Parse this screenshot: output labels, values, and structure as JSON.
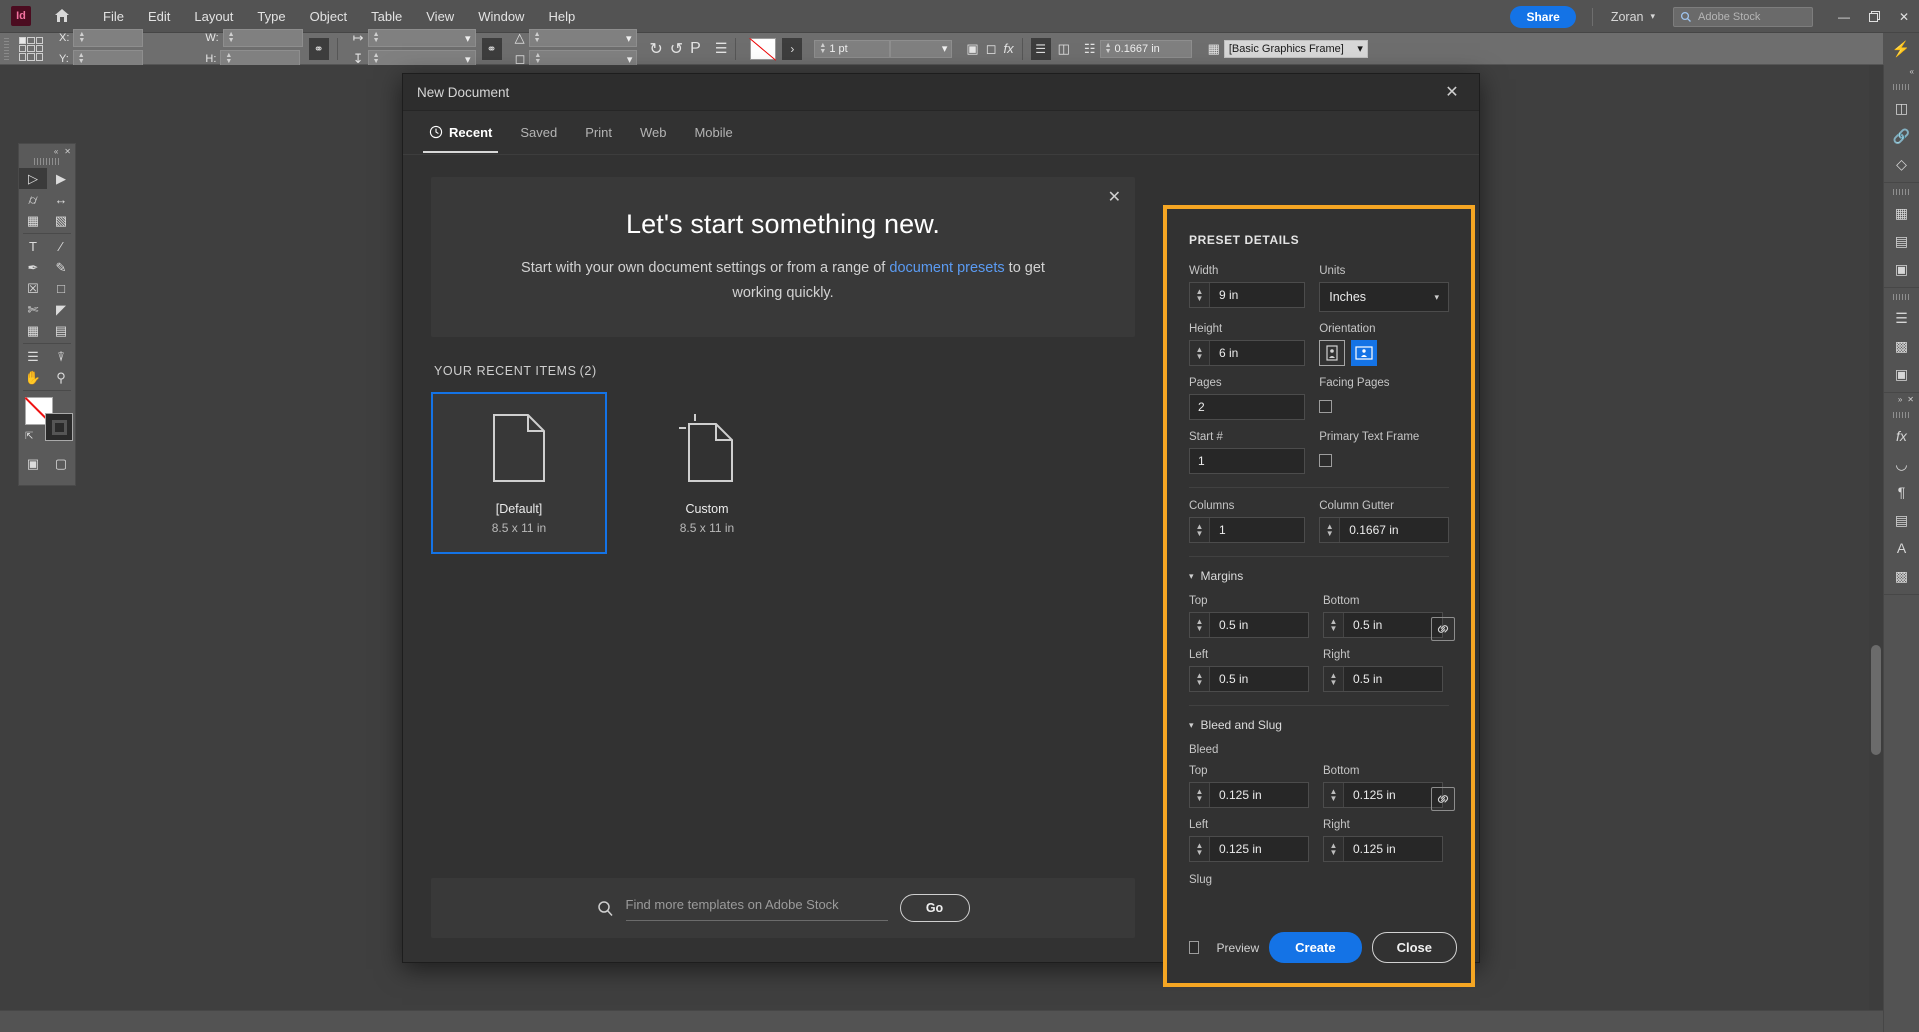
{
  "app": {
    "logo_text": "Id",
    "menus": [
      "File",
      "Edit",
      "Layout",
      "Type",
      "Object",
      "Table",
      "View",
      "Window",
      "Help"
    ],
    "share_label": "Share",
    "user_name": "Zoran",
    "stock_placeholder": "Adobe Stock",
    "window_controls": {
      "minimize": "—",
      "restore": "❐",
      "close": "✕"
    }
  },
  "control_bar": {
    "x_label": "X:",
    "y_label": "Y:",
    "w_label": "W:",
    "h_label": "H:",
    "x_value": "",
    "y_value": "",
    "w_value": "",
    "h_value": "",
    "rotate_value": "",
    "shear_value": "",
    "stroke_weight": "1 pt",
    "gutter_value": "0.1667 in",
    "object_style": "[Basic Graphics Frame]"
  },
  "dialog": {
    "title": "New Document",
    "close_icon": "✕",
    "tabs": [
      {
        "label": "Recent",
        "icon": "clock-icon",
        "active": true
      },
      {
        "label": "Saved",
        "icon": "",
        "active": false
      },
      {
        "label": "Print",
        "icon": "",
        "active": false
      },
      {
        "label": "Web",
        "icon": "",
        "active": false
      },
      {
        "label": "Mobile",
        "icon": "",
        "active": false
      }
    ],
    "hero": {
      "heading": "Let's start something new.",
      "body_before": "Start with your own document settings or from a range of ",
      "link": "document presets",
      "body_after": " to get working quickly.",
      "close_icon": "✕"
    },
    "recent": {
      "heading": "YOUR RECENT ITEMS",
      "count": "(2)",
      "items": [
        {
          "name": "[Default]",
          "size": "8.5 x 11 in",
          "selected": true,
          "thumb": "document-icon"
        },
        {
          "name": "Custom",
          "size": "8.5 x 11 in",
          "selected": false,
          "thumb": "custom-document-icon"
        }
      ]
    },
    "search": {
      "placeholder": "Find more templates on Adobe Stock",
      "value": "",
      "go_label": "Go",
      "icon": "search-icon"
    },
    "preset": {
      "title": "PRESET DETAILS",
      "width_label": "Width",
      "width_value": "9 in",
      "units_label": "Units",
      "units_value": "Inches",
      "height_label": "Height",
      "height_value": "6 in",
      "orientation_label": "Orientation",
      "orientation_selected": "landscape",
      "pages_label": "Pages",
      "pages_value": "2",
      "facing_pages_label": "Facing Pages",
      "facing_pages_checked": false,
      "start_label": "Start #",
      "start_value": "1",
      "primary_text_frame_label": "Primary Text Frame",
      "primary_text_frame_checked": false,
      "columns_label": "Columns",
      "columns_value": "1",
      "gutter_label": "Column Gutter",
      "gutter_value": "0.1667 in",
      "margins_section": "Margins",
      "margin_top_label": "Top",
      "margin_top_value": "0.5 in",
      "margin_bottom_label": "Bottom",
      "margin_bottom_value": "0.5 in",
      "margin_left_label": "Left",
      "margin_left_value": "0.5 in",
      "margin_right_label": "Right",
      "margin_right_value": "0.5 in",
      "bleed_slug_section": "Bleed and Slug",
      "bleed_label": "Bleed",
      "bleed_top_label": "Top",
      "bleed_top_value": "0.125 in",
      "bleed_bottom_label": "Bottom",
      "bleed_bottom_value": "0.125 in",
      "bleed_left_label": "Left",
      "bleed_left_value": "0.125 in",
      "bleed_right_label": "Right",
      "bleed_right_value": "0.125 in",
      "slug_label": "Slug",
      "preview_label": "Preview",
      "preview_checked": false,
      "create_label": "Create",
      "close_label": "Close",
      "highlight_color": "#f5a623",
      "accent_color": "#1473e6"
    }
  }
}
